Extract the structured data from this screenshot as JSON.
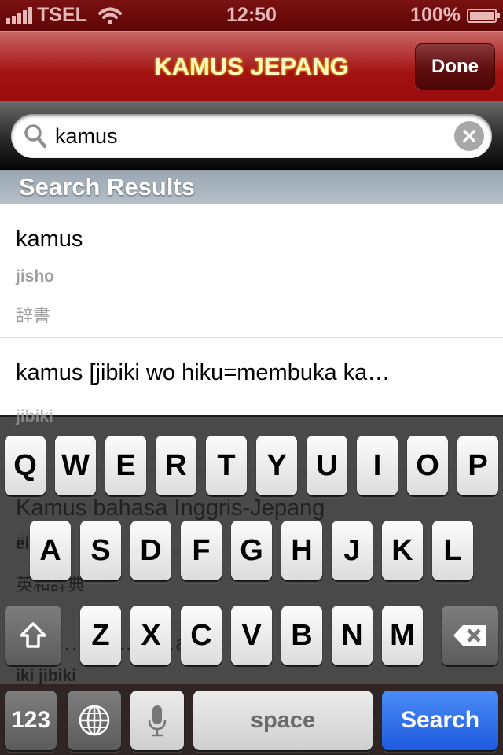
{
  "status_bar": {
    "carrier": "TSEL",
    "time": "12:50",
    "battery_percent": "100%",
    "signal_bars": 5,
    "battery_level": 1.0,
    "icons": [
      "signal-icon",
      "wifi-icon",
      "battery-icon"
    ]
  },
  "nav_bar": {
    "title": "KAMUS JEPANG",
    "done_label": "Done",
    "brand_color": "#a31212",
    "title_color": "#fff5c0"
  },
  "search": {
    "value": "kamus",
    "placeholder": "",
    "icons": [
      "search-icon",
      "clear-icon"
    ]
  },
  "section": {
    "header": "Search Results"
  },
  "results": [
    {
      "title": "kamus",
      "reading": "jisho",
      "kanji": "辞書"
    },
    {
      "title": "kamus [jibiki wo hiku=membuka ka…",
      "reading": "jibiki",
      "kanji": ""
    },
    {
      "title": "Kamus bahasa Inggris-Jepang",
      "reading": "ei…t…",
      "kanji": "英和辞典"
    },
    {
      "title": "…mu…e…a…",
      "reading": "iki jibiki",
      "kanji": ""
    }
  ],
  "keyboard": {
    "row1": [
      "Q",
      "W",
      "E",
      "R",
      "T",
      "Y",
      "U",
      "I",
      "O",
      "P"
    ],
    "row2": [
      "A",
      "S",
      "D",
      "F",
      "G",
      "H",
      "J",
      "K",
      "L"
    ],
    "row3": [
      "Z",
      "X",
      "C",
      "V",
      "B",
      "N",
      "M"
    ],
    "numbers_label": "123",
    "space_label": "space",
    "action_label": "Search",
    "action_color": "#2a6ae8",
    "icons": [
      "shift-icon",
      "delete-icon",
      "globe-icon",
      "microphone-icon"
    ]
  }
}
